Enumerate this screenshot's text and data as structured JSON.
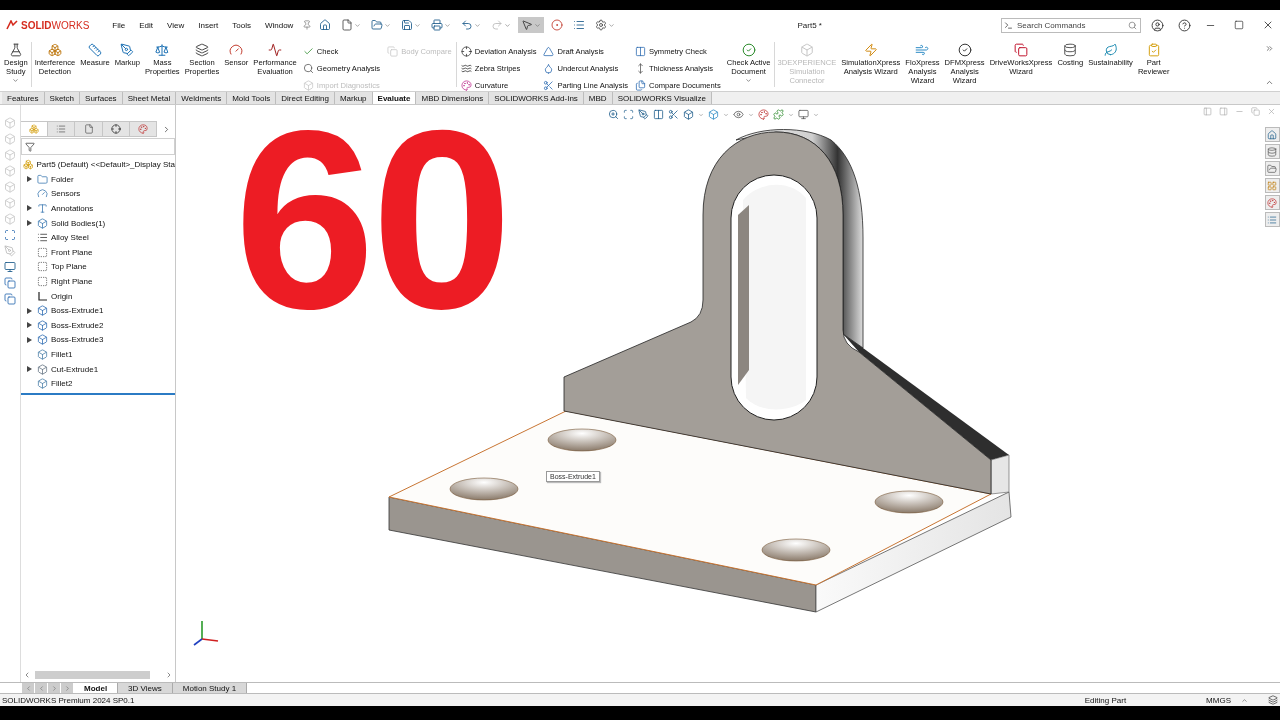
{
  "app": {
    "logo": "**SOLID**WORKS"
  },
  "menu": [
    "File",
    "Edit",
    "View",
    "Insert",
    "Tools",
    "Window"
  ],
  "document_title": "Part5 *",
  "search": {
    "placeholder": "Search Commands"
  },
  "ribbon": [
    {
      "kind": "large",
      "label": "Design\nStudy",
      "dropdown": true,
      "disabled": false
    },
    {
      "kind": "separator"
    },
    {
      "kind": "large",
      "label": "Interference\nDetection",
      "dropdown": false,
      "disabled": false
    },
    {
      "kind": "large",
      "label": "Measure",
      "dropdown": false,
      "disabled": false
    },
    {
      "kind": "large",
      "label": "Markup",
      "dropdown": false,
      "disabled": false
    },
    {
      "kind": "large",
      "label": "Mass\nProperties",
      "dropdown": false,
      "disabled": false
    },
    {
      "kind": "large",
      "label": "Section\nProperties",
      "dropdown": false,
      "disabled": false
    },
    {
      "kind": "large",
      "label": "Sensor",
      "dropdown": false,
      "disabled": false
    },
    {
      "kind": "large",
      "label": "Performance\nEvaluation",
      "dropdown": false,
      "disabled": false
    },
    {
      "kind": "column",
      "entries": [
        {
          "label": "Check",
          "disabled": false
        },
        {
          "label": "Geometry Analysis",
          "disabled": false
        },
        {
          "label": "Import Diagnostics",
          "disabled": true
        }
      ]
    },
    {
      "kind": "column",
      "entries": [
        {
          "label": "Body Compare",
          "disabled": true
        }
      ]
    },
    {
      "kind": "separator"
    },
    {
      "kind": "column",
      "entries": [
        {
          "label": "Deviation Analysis",
          "disabled": false
        },
        {
          "label": "Zebra Stripes",
          "disabled": false
        },
        {
          "label": "Curvature",
          "disabled": false
        }
      ]
    },
    {
      "kind": "column",
      "entries": [
        {
          "label": "Draft Analysis",
          "disabled": false
        },
        {
          "label": "Undercut Analysis",
          "disabled": false
        },
        {
          "label": "Parting Line Analysis",
          "disabled": false
        }
      ]
    },
    {
      "kind": "column",
      "entries": [
        {
          "label": "Symmetry Check",
          "disabled": false
        },
        {
          "label": "Thickness Analysis",
          "disabled": false
        },
        {
          "label": "Compare Documents",
          "disabled": false
        }
      ]
    },
    {
      "kind": "large",
      "label": "Check Active\nDocument",
      "dropdown": true,
      "disabled": false
    },
    {
      "kind": "separator"
    },
    {
      "kind": "large",
      "label": "3DEXPERIENCE\nSimulation\nConnector",
      "dropdown": false,
      "disabled": true
    },
    {
      "kind": "large",
      "label": "SimulationXpress\nAnalysis Wizard",
      "dropdown": false,
      "disabled": false
    },
    {
      "kind": "large",
      "label": "FloXpress\nAnalysis\nWizard",
      "dropdown": false,
      "disabled": false
    },
    {
      "kind": "large",
      "label": "DFMXpress\nAnalysis\nWizard",
      "dropdown": false,
      "disabled": false
    },
    {
      "kind": "large",
      "label": "DriveWorksXpress\nWizard",
      "dropdown": false,
      "disabled": false
    },
    {
      "kind": "large",
      "label": "Costing",
      "dropdown": false,
      "disabled": false
    },
    {
      "kind": "large",
      "label": "Sustainability",
      "dropdown": false,
      "disabled": false
    },
    {
      "kind": "large",
      "label": "Part\nReviewer",
      "dropdown": false,
      "disabled": false
    }
  ],
  "tabs": [
    {
      "label": "Features",
      "selected": false
    },
    {
      "label": "Sketch",
      "selected": false
    },
    {
      "label": "Surfaces",
      "selected": false
    },
    {
      "label": "Sheet Metal",
      "selected": false
    },
    {
      "label": "Weldments",
      "selected": false
    },
    {
      "label": "Mold Tools",
      "selected": false
    },
    {
      "label": "Direct Editing",
      "selected": false
    },
    {
      "label": "Markup",
      "selected": false
    },
    {
      "label": "Evaluate",
      "selected": true
    },
    {
      "label": "MBD Dimensions",
      "selected": false
    },
    {
      "label": "SOLIDWORKS Add-Ins",
      "selected": false
    },
    {
      "label": "MBD",
      "selected": false
    },
    {
      "label": "SOLIDWORKS Visualize",
      "selected": false
    }
  ],
  "feature_manager_tabs": [
    {
      "selected": true
    },
    {
      "selected": false
    },
    {
      "selected": false
    },
    {
      "selected": false
    },
    {
      "selected": false
    }
  ],
  "feature_tree": {
    "label": "Part5 (Default) <<Default>_Display Sta",
    "children": [
      {
        "label": "Folder",
        "kind": "folder",
        "expandable": true
      },
      {
        "label": "Sensors",
        "kind": "sensor",
        "expandable": false
      },
      {
        "label": "Annotations",
        "kind": "annotation",
        "expandable": true
      },
      {
        "label": "Solid Bodies(1)",
        "kind": "bodies",
        "expandable": true
      },
      {
        "label": "Alloy Steel",
        "kind": "material",
        "expandable": false
      },
      {
        "label": "Front Plane",
        "kind": "plane",
        "expandable": false
      },
      {
        "label": "Top Plane",
        "kind": "plane",
        "expandable": false
      },
      {
        "label": "Right Plane",
        "kind": "plane",
        "expandable": false
      },
      {
        "label": "Origin",
        "kind": "origin",
        "expandable": false
      },
      {
        "label": "Boss-Extrude1",
        "kind": "feature",
        "expandable": true
      },
      {
        "label": "Boss-Extrude2",
        "kind": "feature",
        "expandable": true
      },
      {
        "label": "Boss-Extrude3",
        "kind": "feature",
        "expandable": true
      },
      {
        "label": "Fillet1",
        "kind": "fillet",
        "expandable": false
      },
      {
        "label": "Cut-Extrude1",
        "kind": "cut",
        "expandable": true
      },
      {
        "label": "Fillet2",
        "kind": "fillet",
        "expandable": false
      }
    ]
  },
  "viewport": {
    "overlay_text": "60",
    "tooltip": "Boss-Extrude1"
  },
  "bottom_tabs": [
    {
      "label": "Model",
      "selected": true
    },
    {
      "label": "3D Views",
      "selected": false
    },
    {
      "label": "Motion Study 1",
      "selected": false
    }
  ],
  "status_bar": {
    "product": "SOLIDWORKS Premium 2024 SP0.1",
    "mode": "Editing Part",
    "units": "MMGS"
  }
}
